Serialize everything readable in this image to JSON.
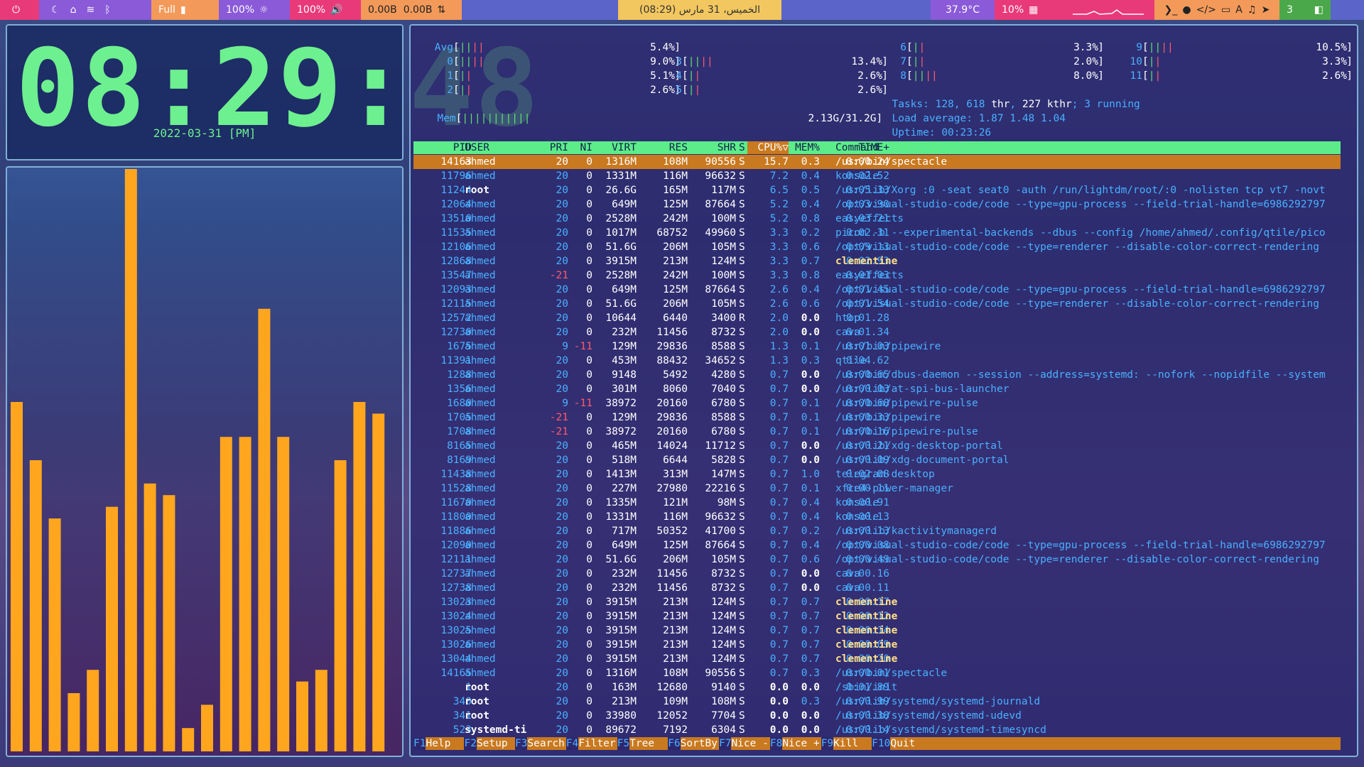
{
  "topbar": {
    "power_icon": "power-icon",
    "icons_left": [
      "moon-icon",
      "home-network-icon",
      "wifi-icon",
      "bluetooth-icon"
    ],
    "battery_label": "Full",
    "brightness": "100%",
    "volume": "100%",
    "net_down": "0.00B",
    "net_up": "0.00B",
    "date_time": "الخميس، 31 مارس (08:29)",
    "temperature": "37.9°C",
    "memory": "10%",
    "workspace": "3",
    "icons_right": [
      "terminal-icon",
      "browser-icon",
      "code-icon",
      "folder-icon",
      "font-icon",
      "music-icon",
      "telegram-icon"
    ],
    "colors": {
      "bar": "#5b64c8",
      "pink": "#e83a78",
      "orange": "#f39a5a",
      "yellow": "#f3c760",
      "purple": "#8a5ad8"
    }
  },
  "clock": {
    "time": "08:29:48",
    "date": "2022-03-31 [PM]"
  },
  "cava": {
    "bar_color": "#ffa61e",
    "levels": [
      0.3,
      0.25,
      0.2,
      0.05,
      0.07,
      0.21,
      0.5,
      0.23,
      0.22,
      0.02,
      0.04,
      0.27,
      0.27,
      0.38,
      0.27,
      0.06,
      0.07,
      0.25,
      0.3,
      0.29
    ]
  },
  "htop": {
    "cpu_left": [
      {
        "label": "Avg",
        "bar": "||||",
        "pct": "5.4%"
      },
      {
        "label": "0",
        "bar": "||||",
        "pct": "9.0%"
      },
      {
        "label": "1",
        "bar": "||",
        "pct": "5.1%"
      },
      {
        "label": "2",
        "bar": "||",
        "pct": "2.6%"
      }
    ],
    "cpu_mid": [
      {
        "label": "3",
        "bar": "||||",
        "pct": "13.4%"
      },
      {
        "label": "4",
        "bar": "||",
        "pct": "2.6%"
      },
      {
        "label": "5",
        "bar": "||",
        "pct": "2.6%"
      }
    ],
    "cpu_right1": [
      {
        "label": "6",
        "bar": "||",
        "pct": "3.3%"
      },
      {
        "label": "7",
        "bar": "||",
        "pct": "2.0%"
      },
      {
        "label": "8",
        "bar": "||||",
        "pct": "8.0%"
      }
    ],
    "cpu_right2": [
      {
        "label": "9",
        "bar": "||||",
        "pct": "10.5%"
      },
      {
        "label": "10",
        "bar": "||",
        "pct": "3.3%"
      },
      {
        "label": "11",
        "bar": "||",
        "pct": "2.6%"
      }
    ],
    "mem": {
      "label": "Mem",
      "bar": "|||||||||||",
      "value": "2.13G/31.2G"
    },
    "tasks": {
      "label": "Tasks:",
      "procs": "128",
      "thr": "618",
      "thr_label": "thr",
      "kthr": "227",
      "kthr_label": "kthr",
      "running": "3",
      "running_label": "running"
    },
    "load": {
      "label": "Load average:",
      "l1": "1.87",
      "l5": "1.48",
      "l15": "1.04"
    },
    "uptime": {
      "label": "Uptime:",
      "value": "00:23:26"
    },
    "columns": [
      "PID",
      "USER",
      "PRI",
      "NI",
      "VIRT",
      "RES",
      "SHR",
      "S",
      "CPU%▽",
      "MEM%",
      "TIME+",
      "Command"
    ],
    "processes": [
      [
        "14163",
        "ahmed",
        "20",
        "0",
        "1316M",
        "108M",
        "90556",
        "S",
        "15.7",
        "0.3",
        "0:00.24",
        "/usr/bin/spectacle"
      ],
      [
        "11796",
        "ahmed",
        "20",
        "0",
        "1331M",
        "116M",
        "96632",
        "S",
        "7.2",
        "0.4",
        "0:02.52",
        "konsole"
      ],
      [
        "11244",
        "root",
        "20",
        "0",
        "26.6G",
        "165M",
        "117M",
        "S",
        "6.5",
        "0.5",
        "0:05.33",
        "/usr/lib/Xorg :0 -seat seat0 -auth /run/lightdm/root/:0 -nolisten tcp vt7 -novt"
      ],
      [
        "12064",
        "ahmed",
        "20",
        "0",
        "649M",
        "125M",
        "87664",
        "S",
        "5.2",
        "0.4",
        "0:03.90",
        "/opt/visual-studio-code/code --type=gpu-process --field-trial-handle=6986292797"
      ],
      [
        "13510",
        "ahmed",
        "20",
        "0",
        "2528M",
        "242M",
        "100M",
        "S",
        "5.2",
        "0.8",
        "0:03.21",
        "easyeffects"
      ],
      [
        "11535",
        "ahmed",
        "20",
        "0",
        "1017M",
        "68752",
        "49960",
        "S",
        "3.3",
        "0.2",
        "0:02.31",
        "picom -b --experimental-backends --dbus --config /home/ahmed/.config/qtile/pico"
      ],
      [
        "12106",
        "ahmed",
        "20",
        "0",
        "51.6G",
        "206M",
        "105M",
        "S",
        "3.3",
        "0.6",
        "0:09.13",
        "/opt/visual-studio-code/code --type=renderer --disable-color-correct-rendering"
      ],
      [
        "12868",
        "ahmed",
        "20",
        "0",
        "3915M",
        "213M",
        "124M",
        "S",
        "3.3",
        "0.7",
        "0:02.93",
        "clementine"
      ],
      [
        "13547",
        "ahmed",
        "-21",
        "0",
        "2528M",
        "242M",
        "100M",
        "S",
        "3.3",
        "0.8",
        "0:01.03",
        "easyeffects"
      ],
      [
        "12093",
        "ahmed",
        "20",
        "0",
        "649M",
        "125M",
        "87664",
        "S",
        "2.6",
        "0.4",
        "0:01.45",
        "/opt/visual-studio-code/code --type=gpu-process --field-trial-handle=6986292797"
      ],
      [
        "12115",
        "ahmed",
        "20",
        "0",
        "51.6G",
        "206M",
        "105M",
        "S",
        "2.6",
        "0.6",
        "0:01.54",
        "/opt/visual-studio-code/code --type=renderer --disable-color-correct-rendering"
      ],
      [
        "12572",
        "ahmed",
        "20",
        "0",
        "10644",
        "6440",
        "3400",
        "R",
        "2.0",
        "0.0",
        "0:01.28",
        "htop"
      ],
      [
        "12730",
        "ahmed",
        "20",
        "0",
        "232M",
        "11456",
        "8732",
        "S",
        "2.0",
        "0.0",
        "0:01.34",
        "cava"
      ],
      [
        "1675",
        "ahmed",
        "9",
        "-11",
        "129M",
        "29836",
        "8588",
        "S",
        "1.3",
        "0.1",
        "0:01.03",
        "/usr/bin/pipewire"
      ],
      [
        "11391",
        "ahmed",
        "20",
        "0",
        "453M",
        "88432",
        "34652",
        "S",
        "1.3",
        "0.3",
        "0:04.62",
        "qtile"
      ],
      [
        "1288",
        "ahmed",
        "20",
        "0",
        "9148",
        "5492",
        "4280",
        "S",
        "0.7",
        "0.0",
        "0:00.65",
        "/usr/bin/dbus-daemon --session --address=systemd: --nofork --nopidfile --system"
      ],
      [
        "1356",
        "ahmed",
        "20",
        "0",
        "301M",
        "8060",
        "7040",
        "S",
        "0.7",
        "0.0",
        "0:00.03",
        "/usr/lib/at-spi-bus-launcher"
      ],
      [
        "1680",
        "ahmed",
        "9",
        "-11",
        "38972",
        "20160",
        "6780",
        "S",
        "0.7",
        "0.1",
        "0:00.68",
        "/usr/bin/pipewire-pulse"
      ],
      [
        "1705",
        "ahmed",
        "-21",
        "0",
        "129M",
        "29836",
        "8588",
        "S",
        "0.7",
        "0.1",
        "0:00.33",
        "/usr/bin/pipewire"
      ],
      [
        "1708",
        "ahmed",
        "-21",
        "0",
        "38972",
        "20160",
        "6780",
        "S",
        "0.7",
        "0.1",
        "0:00.16",
        "/usr/bin/pipewire-pulse"
      ],
      [
        "8165",
        "ahmed",
        "20",
        "0",
        "465M",
        "14024",
        "11712",
        "S",
        "0.7",
        "0.0",
        "0:00.21",
        "/usr/lib/xdg-desktop-portal"
      ],
      [
        "8169",
        "ahmed",
        "20",
        "0",
        "518M",
        "6644",
        "5828",
        "S",
        "0.7",
        "0.0",
        "0:00.09",
        "/usr/lib/xdg-document-portal"
      ],
      [
        "11438",
        "ahmed",
        "20",
        "0",
        "1413M",
        "313M",
        "147M",
        "S",
        "0.7",
        "1.0",
        "0:02.08",
        "telegram-desktop"
      ],
      [
        "11528",
        "ahmed",
        "20",
        "0",
        "227M",
        "27980",
        "22216",
        "S",
        "0.7",
        "0.1",
        "0:00.11",
        "xfce4-power-manager"
      ],
      [
        "11670",
        "ahmed",
        "20",
        "0",
        "1335M",
        "121M",
        "98M",
        "S",
        "0.7",
        "0.4",
        "0:00.91",
        "konsole"
      ],
      [
        "11800",
        "ahmed",
        "20",
        "0",
        "1331M",
        "116M",
        "96632",
        "S",
        "0.7",
        "0.4",
        "0:00.13",
        "konsole"
      ],
      [
        "11886",
        "ahmed",
        "20",
        "0",
        "717M",
        "50352",
        "41700",
        "S",
        "0.7",
        "0.2",
        "0:00.13",
        "/usr/lib/kactivitymanagerd"
      ],
      [
        "12090",
        "ahmed",
        "20",
        "0",
        "649M",
        "125M",
        "87664",
        "S",
        "0.7",
        "0.4",
        "0:00.08",
        "/opt/visual-studio-code/code --type=gpu-process --field-trial-handle=6986292797"
      ],
      [
        "12111",
        "ahmed",
        "20",
        "0",
        "51.6G",
        "206M",
        "105M",
        "S",
        "0.7",
        "0.6",
        "0:00.49",
        "/opt/visual-studio-code/code --type=renderer --disable-color-correct-rendering"
      ],
      [
        "12737",
        "ahmed",
        "20",
        "0",
        "232M",
        "11456",
        "8732",
        "S",
        "0.7",
        "0.0",
        "0:00.16",
        "cava"
      ],
      [
        "12738",
        "ahmed",
        "20",
        "0",
        "232M",
        "11456",
        "8732",
        "S",
        "0.7",
        "0.0",
        "0:00.11",
        "cava"
      ],
      [
        "13023",
        "ahmed",
        "20",
        "0",
        "3915M",
        "213M",
        "124M",
        "S",
        "0.7",
        "0.7",
        "0:00.17",
        "clementine"
      ],
      [
        "13024",
        "ahmed",
        "20",
        "0",
        "3915M",
        "213M",
        "124M",
        "S",
        "0.7",
        "0.7",
        "0:00.12",
        "clementine"
      ],
      [
        "13025",
        "ahmed",
        "20",
        "0",
        "3915M",
        "213M",
        "124M",
        "S",
        "0.7",
        "0.7",
        "0:00.14",
        "clementine"
      ],
      [
        "13026",
        "ahmed",
        "20",
        "0",
        "3915M",
        "213M",
        "124M",
        "S",
        "0.7",
        "0.7",
        "0:00.09",
        "clementine"
      ],
      [
        "13044",
        "ahmed",
        "20",
        "0",
        "3915M",
        "213M",
        "124M",
        "S",
        "0.7",
        "0.7",
        "0:00.20",
        "clementine"
      ],
      [
        "14165",
        "ahmed",
        "20",
        "0",
        "1316M",
        "108M",
        "90556",
        "S",
        "0.7",
        "0.3",
        "0:00.01",
        "/usr/bin/spectacle"
      ],
      [
        "1",
        "root",
        "20",
        "0",
        "163M",
        "12680",
        "9140",
        "S",
        "0.0",
        "0.0",
        "0:01.89",
        "/sbin/init"
      ],
      [
        "340",
        "root",
        "20",
        "0",
        "213M",
        "109M",
        "108M",
        "S",
        "0.0",
        "0.3",
        "0:00.99",
        "/usr/lib/systemd/systemd-journald"
      ],
      [
        "341",
        "root",
        "20",
        "0",
        "33980",
        "12052",
        "7704",
        "S",
        "0.0",
        "0.0",
        "0:00.38",
        "/usr/lib/systemd/systemd-udevd"
      ],
      [
        "523",
        "systemd-ti",
        "20",
        "0",
        "89672",
        "7192",
        "6304",
        "S",
        "0.0",
        "0.0",
        "0:00.14",
        "/usr/lib/systemd/systemd-timesyncd"
      ]
    ],
    "fkeys": [
      {
        "key": "F1",
        "label": "Help"
      },
      {
        "key": "F2",
        "label": "Setup"
      },
      {
        "key": "F3",
        "label": "Search"
      },
      {
        "key": "F4",
        "label": "Filter"
      },
      {
        "key": "F5",
        "label": "Tree"
      },
      {
        "key": "F6",
        "label": "SortBy"
      },
      {
        "key": "F7",
        "label": "Nice -"
      },
      {
        "key": "F8",
        "label": "Nice +"
      },
      {
        "key": "F9",
        "label": "Kill"
      },
      {
        "key": "F10",
        "label": "Quit"
      }
    ]
  }
}
